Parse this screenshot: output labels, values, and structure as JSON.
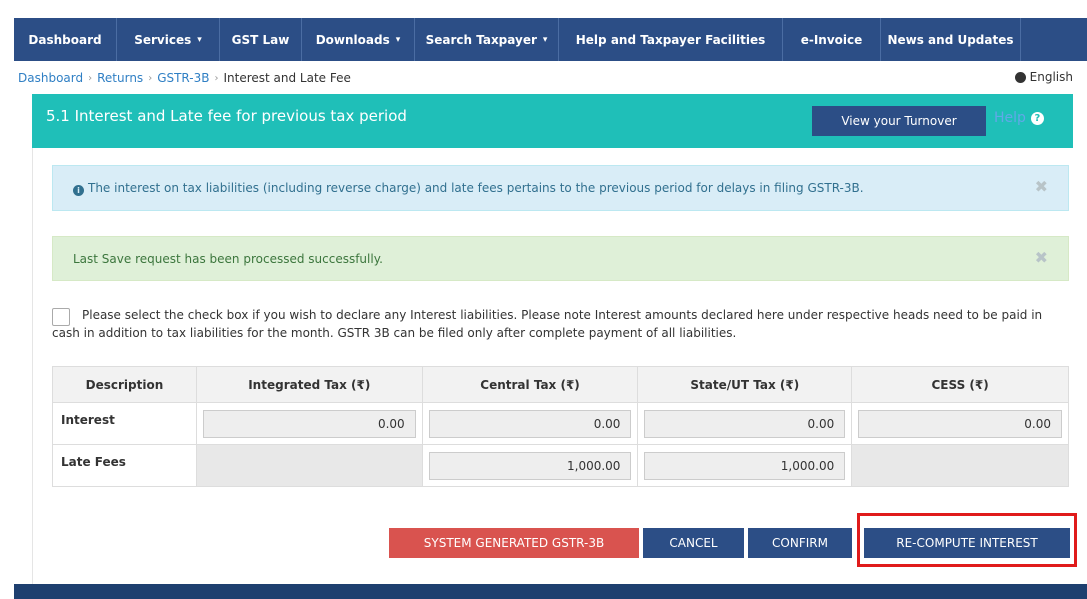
{
  "nav": {
    "items": [
      {
        "label": "Dashboard",
        "caret": false
      },
      {
        "label": "Services",
        "caret": true
      },
      {
        "label": "GST Law",
        "caret": false
      },
      {
        "label": "Downloads",
        "caret": true
      },
      {
        "label": "Search Taxpayer",
        "caret": true
      },
      {
        "label": "Help and Taxpayer Facilities",
        "caret": false
      },
      {
        "label": "e-Invoice",
        "caret": false
      },
      {
        "label": "News and Updates",
        "caret": false
      }
    ],
    "caret_glyph": "▾"
  },
  "breadcrumb": {
    "items": [
      "Dashboard",
      "Returns",
      "GSTR-3B"
    ],
    "current": "Interest and Late Fee",
    "separator": "›"
  },
  "language": "English",
  "panel": {
    "title": "5.1 Interest and Late fee for previous tax period",
    "turnover_button": "View your Turnover",
    "help_label": "Help",
    "help_icon": "?"
  },
  "alerts": {
    "info_icon": "i",
    "info_text": "The interest on tax liabilities (including reverse charge) and late fees pertains to the previous period for delays in filing GSTR-3B.",
    "success_text": "Last Save request has been processed successfully.",
    "close_glyph": "✖"
  },
  "declaration": "Please select the check box if you wish to declare any Interest liabilities. Please note Interest amounts declared here under respective heads need to be paid in cash in addition to tax liabilities for the month. GSTR 3B can be filed only after complete payment of all liabilities.",
  "table": {
    "headers": [
      "Description",
      "Integrated Tax (₹)",
      "Central Tax (₹)",
      "State/UT Tax (₹)",
      "CESS (₹)"
    ],
    "rows": [
      {
        "label": "Interest",
        "values": [
          "0.00",
          "0.00",
          "0.00",
          "0.00"
        ]
      },
      {
        "label": "Late Fees",
        "values": [
          "",
          "1,000.00",
          "1,000.00",
          ""
        ]
      }
    ]
  },
  "buttons": {
    "system_generated": "SYSTEM GENERATED GSTR-3B",
    "cancel": "CANCEL",
    "confirm": "CONFIRM",
    "recompute": "RE-COMPUTE INTEREST"
  },
  "colors": {
    "nav": "#2c4e86",
    "panel_header": "#1fbfb8",
    "danger": "#d9534f",
    "highlight": "#e01b1b"
  }
}
